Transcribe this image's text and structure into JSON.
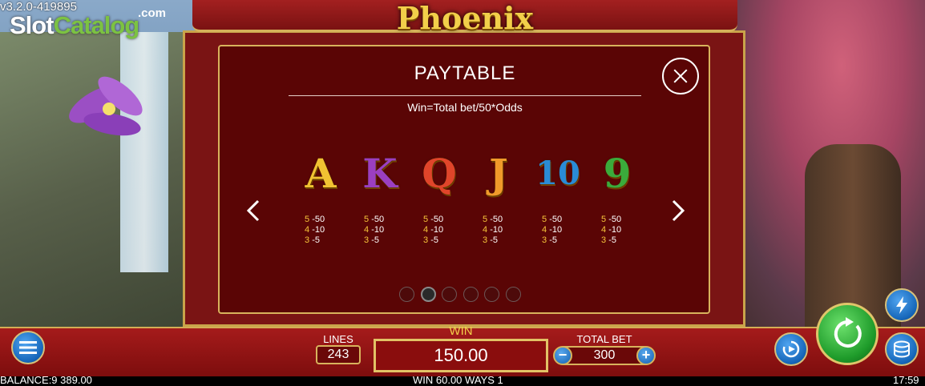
{
  "overlay": {
    "version": "v3.2.0-419895",
    "logo": {
      "slot": "Slot",
      "catalog": "Catalog",
      "com": ".com"
    }
  },
  "game": {
    "title": "Phoenix"
  },
  "paytable": {
    "title": "PAYTABLE",
    "subtitle": "Win=Total bet/50*Odds",
    "symbols": [
      {
        "symbol": "A",
        "color": "#f1c232",
        "odds": [
          {
            "count": "5",
            "value": "-50"
          },
          {
            "count": "4",
            "value": "-10"
          },
          {
            "count": "3",
            "value": "-5"
          }
        ]
      },
      {
        "symbol": "K",
        "color": "#9b3fc1",
        "odds": [
          {
            "count": "5",
            "value": "-50"
          },
          {
            "count": "4",
            "value": "-10"
          },
          {
            "count": "3",
            "value": "-5"
          }
        ]
      },
      {
        "symbol": "Q",
        "color": "#e0452a",
        "odds": [
          {
            "count": "5",
            "value": "-50"
          },
          {
            "count": "4",
            "value": "-10"
          },
          {
            "count": "3",
            "value": "-5"
          }
        ]
      },
      {
        "symbol": "J",
        "color": "#f09a2a",
        "odds": [
          {
            "count": "5",
            "value": "-50"
          },
          {
            "count": "4",
            "value": "-10"
          },
          {
            "count": "3",
            "value": "-5"
          }
        ]
      },
      {
        "symbol": "10",
        "color": "#2a8bd6",
        "odds": [
          {
            "count": "5",
            "value": "-50"
          },
          {
            "count": "4",
            "value": "-10"
          },
          {
            "count": "3",
            "value": "-5"
          }
        ]
      },
      {
        "symbol": "9",
        "color": "#3bab3b",
        "odds": [
          {
            "count": "5",
            "value": "-50"
          },
          {
            "count": "4",
            "value": "-10"
          },
          {
            "count": "3",
            "value": "-5"
          }
        ]
      }
    ],
    "pages": 6,
    "active_page": 2
  },
  "controls": {
    "lines_label": "LINES",
    "lines_value": "243",
    "win_label": "WIN",
    "win_value": "150.00",
    "total_bet_label": "TOTAL BET",
    "total_bet_value": "300",
    "minus": "−",
    "plus": "+"
  },
  "status": {
    "balance": "BALANCE:9 389.00",
    "message": "WIN 60.00 WAYS 1",
    "time": "17:59"
  },
  "icons": [
    "menu-icon",
    "close-icon",
    "chevron-left-icon",
    "chevron-right-icon",
    "spin-icon",
    "autoplay-icon",
    "turbo-icon",
    "coins-icon"
  ]
}
